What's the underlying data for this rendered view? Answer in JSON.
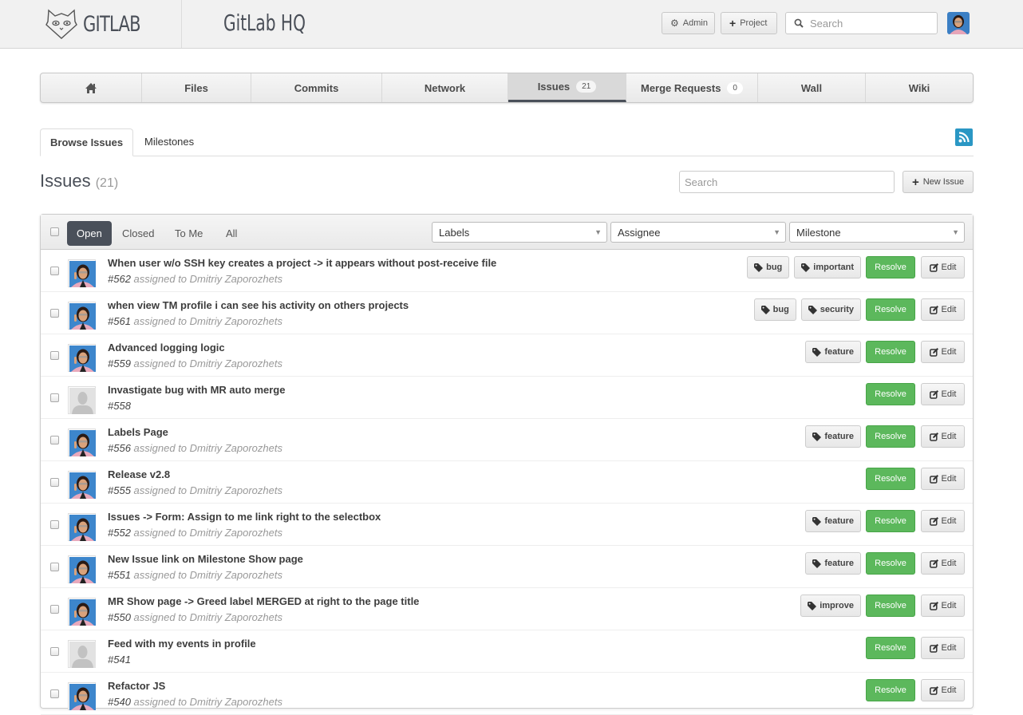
{
  "header": {
    "logo_text": "GITLAB",
    "project_title": "GitLab HQ",
    "admin_label": "Admin",
    "project_label": "Project",
    "search_placeholder": "Search"
  },
  "nav": {
    "items": [
      {
        "label": "",
        "icon": "home-icon"
      },
      {
        "label": "Files"
      },
      {
        "label": "Commits"
      },
      {
        "label": "Network"
      },
      {
        "label": "Issues",
        "badge": "21",
        "active": true
      },
      {
        "label": "Merge Requests",
        "badge": "0"
      },
      {
        "label": "Wall"
      },
      {
        "label": "Wiki"
      }
    ]
  },
  "subtabs": {
    "browse": "Browse Issues",
    "milestones": "Milestones"
  },
  "page": {
    "title": "Issues",
    "count": "(21)",
    "search_placeholder": "Search",
    "new_issue_label": "New Issue"
  },
  "filters": {
    "tabs": [
      "Open",
      "Closed",
      "To Me",
      "All"
    ],
    "active_tab": "Open",
    "labels_select": "Labels",
    "assignee_select": "Assignee",
    "milestone_select": "Milestone"
  },
  "actions": {
    "resolve": "Resolve",
    "edit": "Edit"
  },
  "issues": [
    {
      "title": "When user w/o SSH key creates a project -> it appears without post-receive file",
      "id": "#562",
      "assignee": "assigned to Dmitriy Zaporozhets",
      "labels": [
        "bug",
        "important"
      ],
      "avatar": "user"
    },
    {
      "title": "when view TM profile i can see his activity on others projects",
      "id": "#561",
      "assignee": "assigned to Dmitriy Zaporozhets",
      "labels": [
        "bug",
        "security"
      ],
      "avatar": "user"
    },
    {
      "title": "Advanced logging logic",
      "id": "#559",
      "assignee": "assigned to Dmitriy Zaporozhets",
      "labels": [
        "feature"
      ],
      "avatar": "user"
    },
    {
      "title": "Invastigate bug with MR auto merge",
      "id": "#558",
      "assignee": "",
      "labels": [],
      "avatar": "default"
    },
    {
      "title": "Labels Page",
      "id": "#556",
      "assignee": "assigned to Dmitriy Zaporozhets",
      "labels": [
        "feature"
      ],
      "avatar": "user"
    },
    {
      "title": "Release v2.8",
      "id": "#555",
      "assignee": "assigned to Dmitriy Zaporozhets",
      "labels": [],
      "avatar": "user"
    },
    {
      "title": "Issues -> Form: Assign to me link right to the selectbox",
      "id": "#552",
      "assignee": "assigned to Dmitriy Zaporozhets",
      "labels": [
        "feature"
      ],
      "avatar": "user"
    },
    {
      "title": "New Issue link on Milestone Show page",
      "id": "#551",
      "assignee": "assigned to Dmitriy Zaporozhets",
      "labels": [
        "feature"
      ],
      "avatar": "user"
    },
    {
      "title": "MR Show page -> Greed label MERGED at right to the page title",
      "id": "#550",
      "assignee": "assigned to Dmitriy Zaporozhets",
      "labels": [
        "improve"
      ],
      "avatar": "user"
    },
    {
      "title": "Feed with my events in profile",
      "id": "#541",
      "assignee": "",
      "labels": [],
      "avatar": "default"
    },
    {
      "title": "Refactor JS",
      "id": "#540",
      "assignee": "assigned to Dmitriy Zaporozhets",
      "labels": [],
      "avatar": "user"
    }
  ],
  "colors": {
    "resolve_green": "#5cb85c",
    "active_dark": "#4a505a",
    "rss_blue": "#2a97c4"
  }
}
